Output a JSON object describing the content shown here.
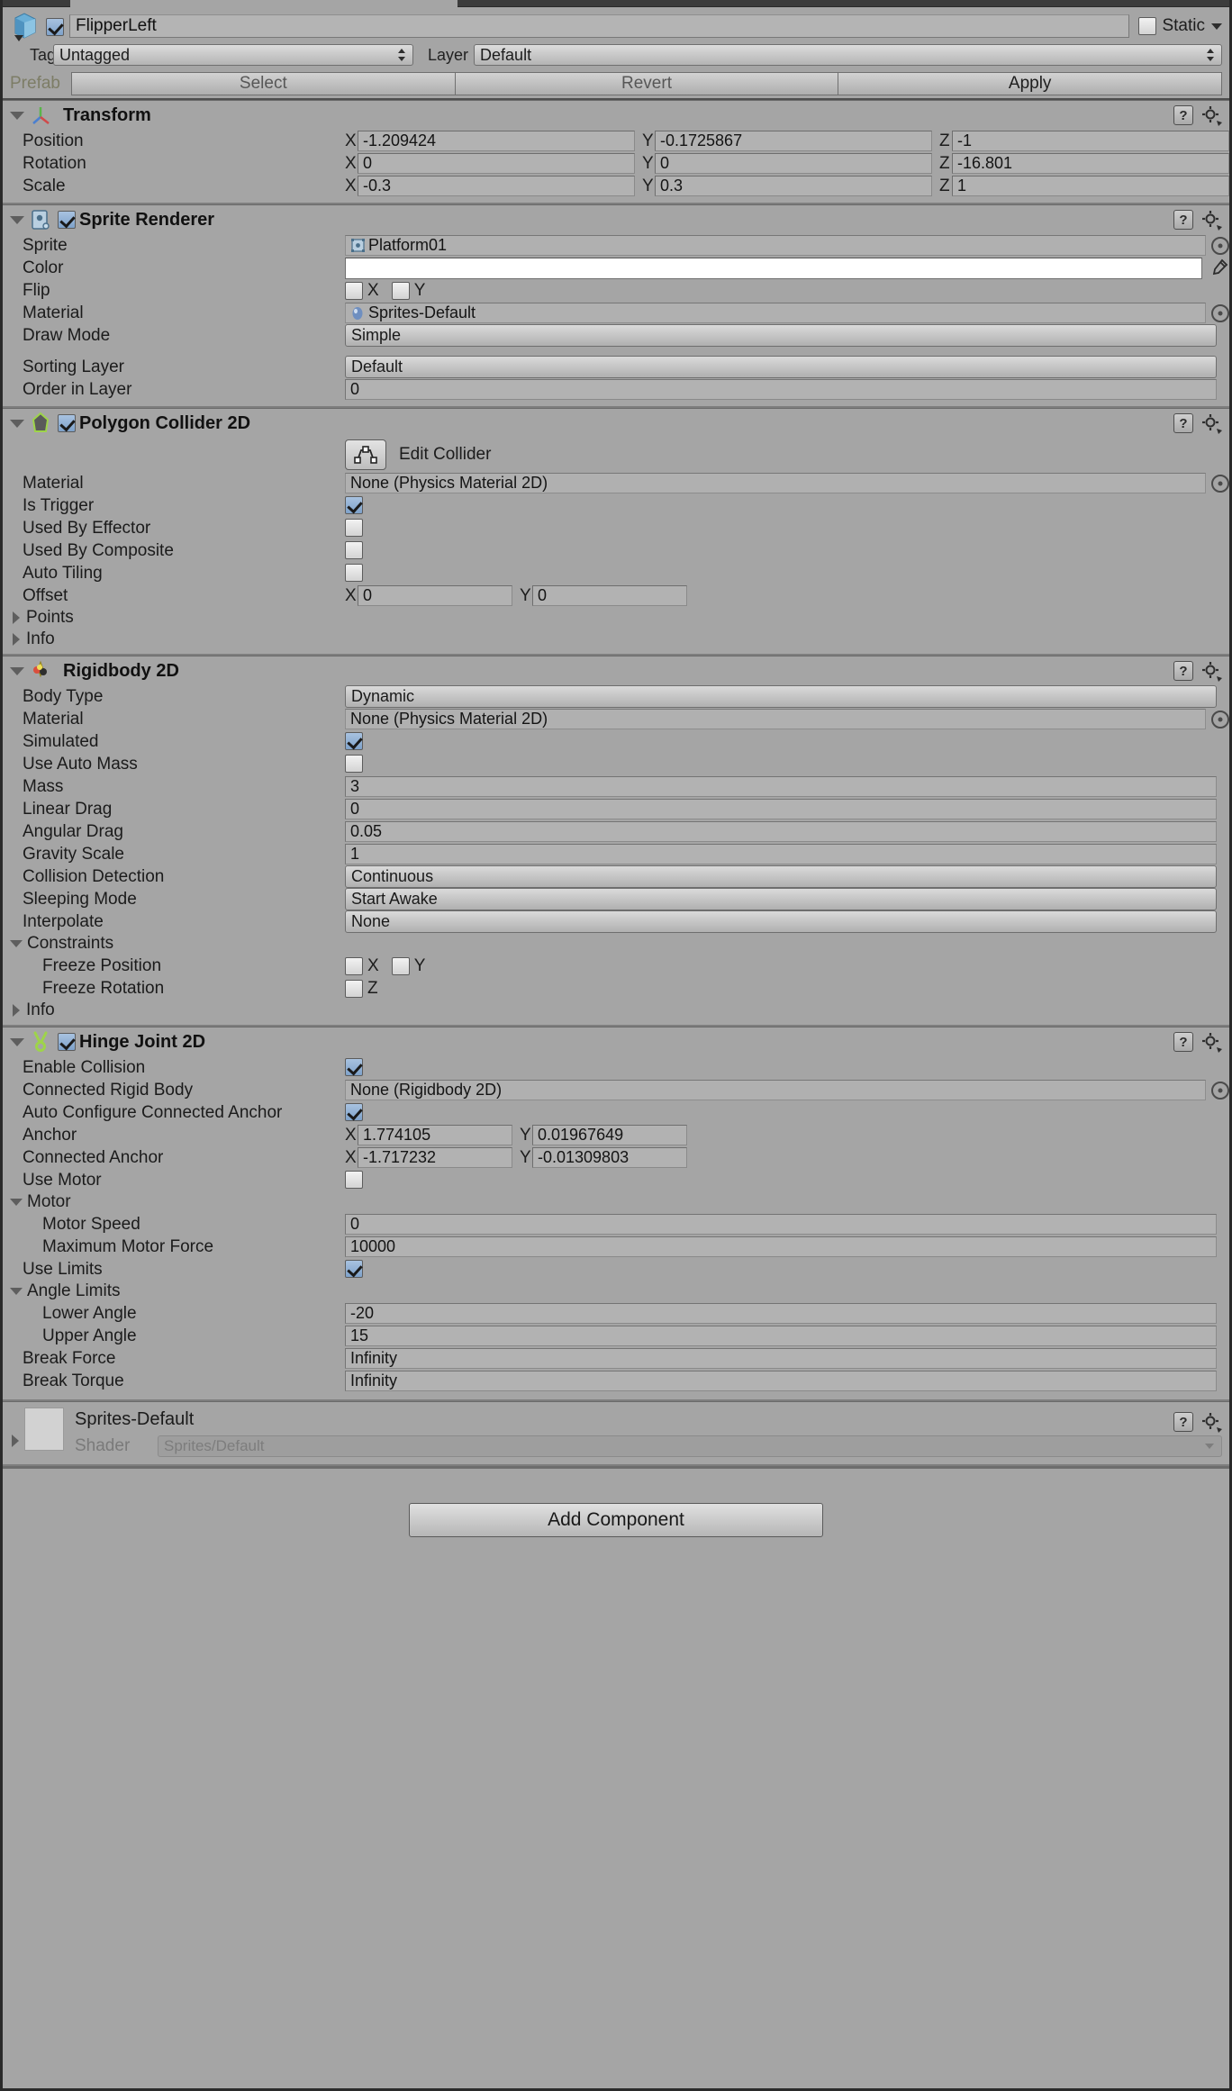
{
  "window": {
    "object_name": "FlipperLeft",
    "enabled": true,
    "static_label": "Static",
    "static_checked": false,
    "tag_label": "Tag",
    "tag_value": "Untagged",
    "layer_label": "Layer",
    "layer_value": "Default",
    "prefab_label": "Prefab",
    "prefab_select": "Select",
    "prefab_revert": "Revert",
    "prefab_apply": "Apply",
    "add_component": "Add Component"
  },
  "transform": {
    "title": "Transform",
    "rows": [
      {
        "label": "Position",
        "x": "-1.209424",
        "y": "-0.1725867",
        "z": "-1"
      },
      {
        "label": "Rotation",
        "x": "0",
        "y": "0",
        "z": "-16.801"
      },
      {
        "label": "Scale",
        "x": "-0.3",
        "y": "0.3",
        "z": "1"
      }
    ],
    "axis_x": "X",
    "axis_y": "Y",
    "axis_z": "Z"
  },
  "sprite_renderer": {
    "title": "Sprite Renderer",
    "enabled": true,
    "sprite_label": "Sprite",
    "sprite_value": "Platform01",
    "color_label": "Color",
    "color_value": "#FFFFFF",
    "flip_label": "Flip",
    "flip_x_label": "X",
    "flip_y_label": "Y",
    "flip_x": false,
    "flip_y": false,
    "material_label": "Material",
    "material_value": "Sprites-Default",
    "draw_mode_label": "Draw Mode",
    "draw_mode_value": "Simple",
    "sorting_layer_label": "Sorting Layer",
    "sorting_layer_value": "Default",
    "order_in_layer_label": "Order in Layer",
    "order_in_layer_value": "0"
  },
  "polygon_collider": {
    "title": "Polygon Collider 2D",
    "enabled": true,
    "edit_collider_label": "Edit Collider",
    "material_label": "Material",
    "material_value": "None (Physics Material 2D)",
    "is_trigger_label": "Is Trigger",
    "is_trigger": true,
    "used_by_effector_label": "Used By Effector",
    "used_by_effector": false,
    "used_by_composite_label": "Used By Composite",
    "used_by_composite": false,
    "auto_tiling_label": "Auto Tiling",
    "auto_tiling": false,
    "offset_label": "Offset",
    "offset_x": "0",
    "offset_y": "0",
    "points_label": "Points",
    "info_label": "Info"
  },
  "rigidbody": {
    "title": "Rigidbody 2D",
    "body_type_label": "Body Type",
    "body_type_value": "Dynamic",
    "material_label": "Material",
    "material_value": "None (Physics Material 2D)",
    "simulated_label": "Simulated",
    "simulated": true,
    "use_auto_mass_label": "Use Auto Mass",
    "use_auto_mass": false,
    "mass_label": "Mass",
    "mass_value": "3",
    "linear_drag_label": "Linear Drag",
    "linear_drag_value": "0",
    "angular_drag_label": "Angular Drag",
    "angular_drag_value": "0.05",
    "gravity_scale_label": "Gravity Scale",
    "gravity_scale_value": "1",
    "collision_detection_label": "Collision Detection",
    "collision_detection_value": "Continuous",
    "sleeping_mode_label": "Sleeping Mode",
    "sleeping_mode_value": "Start Awake",
    "interpolate_label": "Interpolate",
    "interpolate_value": "None",
    "constraints_label": "Constraints",
    "freeze_position_label": "Freeze Position",
    "freeze_position_x_label": "X",
    "freeze_position_y_label": "Y",
    "freeze_position_x": false,
    "freeze_position_y": false,
    "freeze_rotation_label": "Freeze Rotation",
    "freeze_rotation_z_label": "Z",
    "freeze_rotation_z": false,
    "info_label": "Info"
  },
  "hinge_joint": {
    "title": "Hinge Joint 2D",
    "enabled": true,
    "enable_collision_label": "Enable Collision",
    "enable_collision": true,
    "connected_rigid_body_label": "Connected Rigid Body",
    "connected_rigid_body_value": "None (Rigidbody 2D)",
    "auto_configure_label": "Auto Configure Connected Anchor",
    "auto_configure": true,
    "anchor_label": "Anchor",
    "anchor_x": "1.774105",
    "anchor_y": "0.01967649",
    "connected_anchor_label": "Connected Anchor",
    "connected_anchor_x": "-1.717232",
    "connected_anchor_y": "-0.01309803",
    "use_motor_label": "Use Motor",
    "use_motor": false,
    "motor_label": "Motor",
    "motor_speed_label": "Motor Speed",
    "motor_speed_value": "0",
    "max_motor_force_label": "Maximum Motor Force",
    "max_motor_force_value": "10000",
    "use_limits_label": "Use Limits",
    "use_limits": true,
    "angle_limits_label": "Angle Limits",
    "lower_angle_label": "Lower Angle",
    "lower_angle_value": "-20",
    "upper_angle_label": "Upper Angle",
    "upper_angle_value": "15",
    "break_force_label": "Break Force",
    "break_force_value": "Infinity",
    "break_torque_label": "Break Torque",
    "break_torque_value": "Infinity",
    "axis_x": "X",
    "axis_y": "Y"
  },
  "material_footer": {
    "name": "Sprites-Default",
    "shader_label": "Shader",
    "shader_value": "Sprites/Default"
  },
  "colors": {
    "panel_bg": "#a5a5a5",
    "field_bg": "#b2b2b2",
    "checkbox_on": "#7ea2ca",
    "prefab_text": "#7d7d66"
  }
}
